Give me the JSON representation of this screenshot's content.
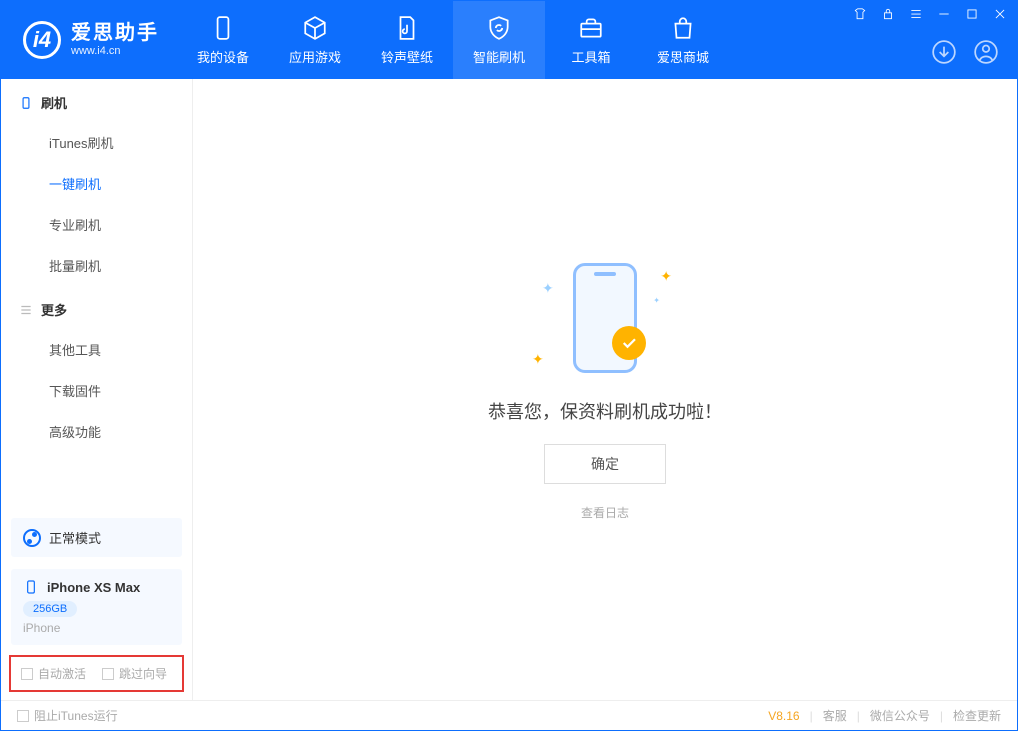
{
  "app": {
    "name_cn": "爱思助手",
    "name_en": "www.i4.cn"
  },
  "nav": [
    {
      "label": "我的设备"
    },
    {
      "label": "应用游戏"
    },
    {
      "label": "铃声壁纸"
    },
    {
      "label": "智能刷机",
      "active": true
    },
    {
      "label": "工具箱"
    },
    {
      "label": "爱思商城"
    }
  ],
  "sidebar": {
    "group1_title": "刷机",
    "group1_items": [
      {
        "label": "iTunes刷机"
      },
      {
        "label": "一键刷机",
        "active": true
      },
      {
        "label": "专业刷机"
      },
      {
        "label": "批量刷机"
      }
    ],
    "group2_title": "更多",
    "group2_items": [
      {
        "label": "其他工具"
      },
      {
        "label": "下载固件"
      },
      {
        "label": "高级功能"
      }
    ]
  },
  "mode": {
    "label": "正常模式"
  },
  "device": {
    "name": "iPhone XS Max",
    "storage": "256GB",
    "type": "iPhone"
  },
  "bottom_checks": {
    "auto_activate": "自动激活",
    "skip_guide": "跳过向导"
  },
  "main": {
    "success_text": "恭喜您，保资料刷机成功啦！",
    "ok_button": "确定",
    "view_log": "查看日志"
  },
  "footer": {
    "block_itunes": "阻止iTunes运行",
    "version": "V8.16",
    "links": [
      "客服",
      "微信公众号",
      "检查更新"
    ]
  }
}
